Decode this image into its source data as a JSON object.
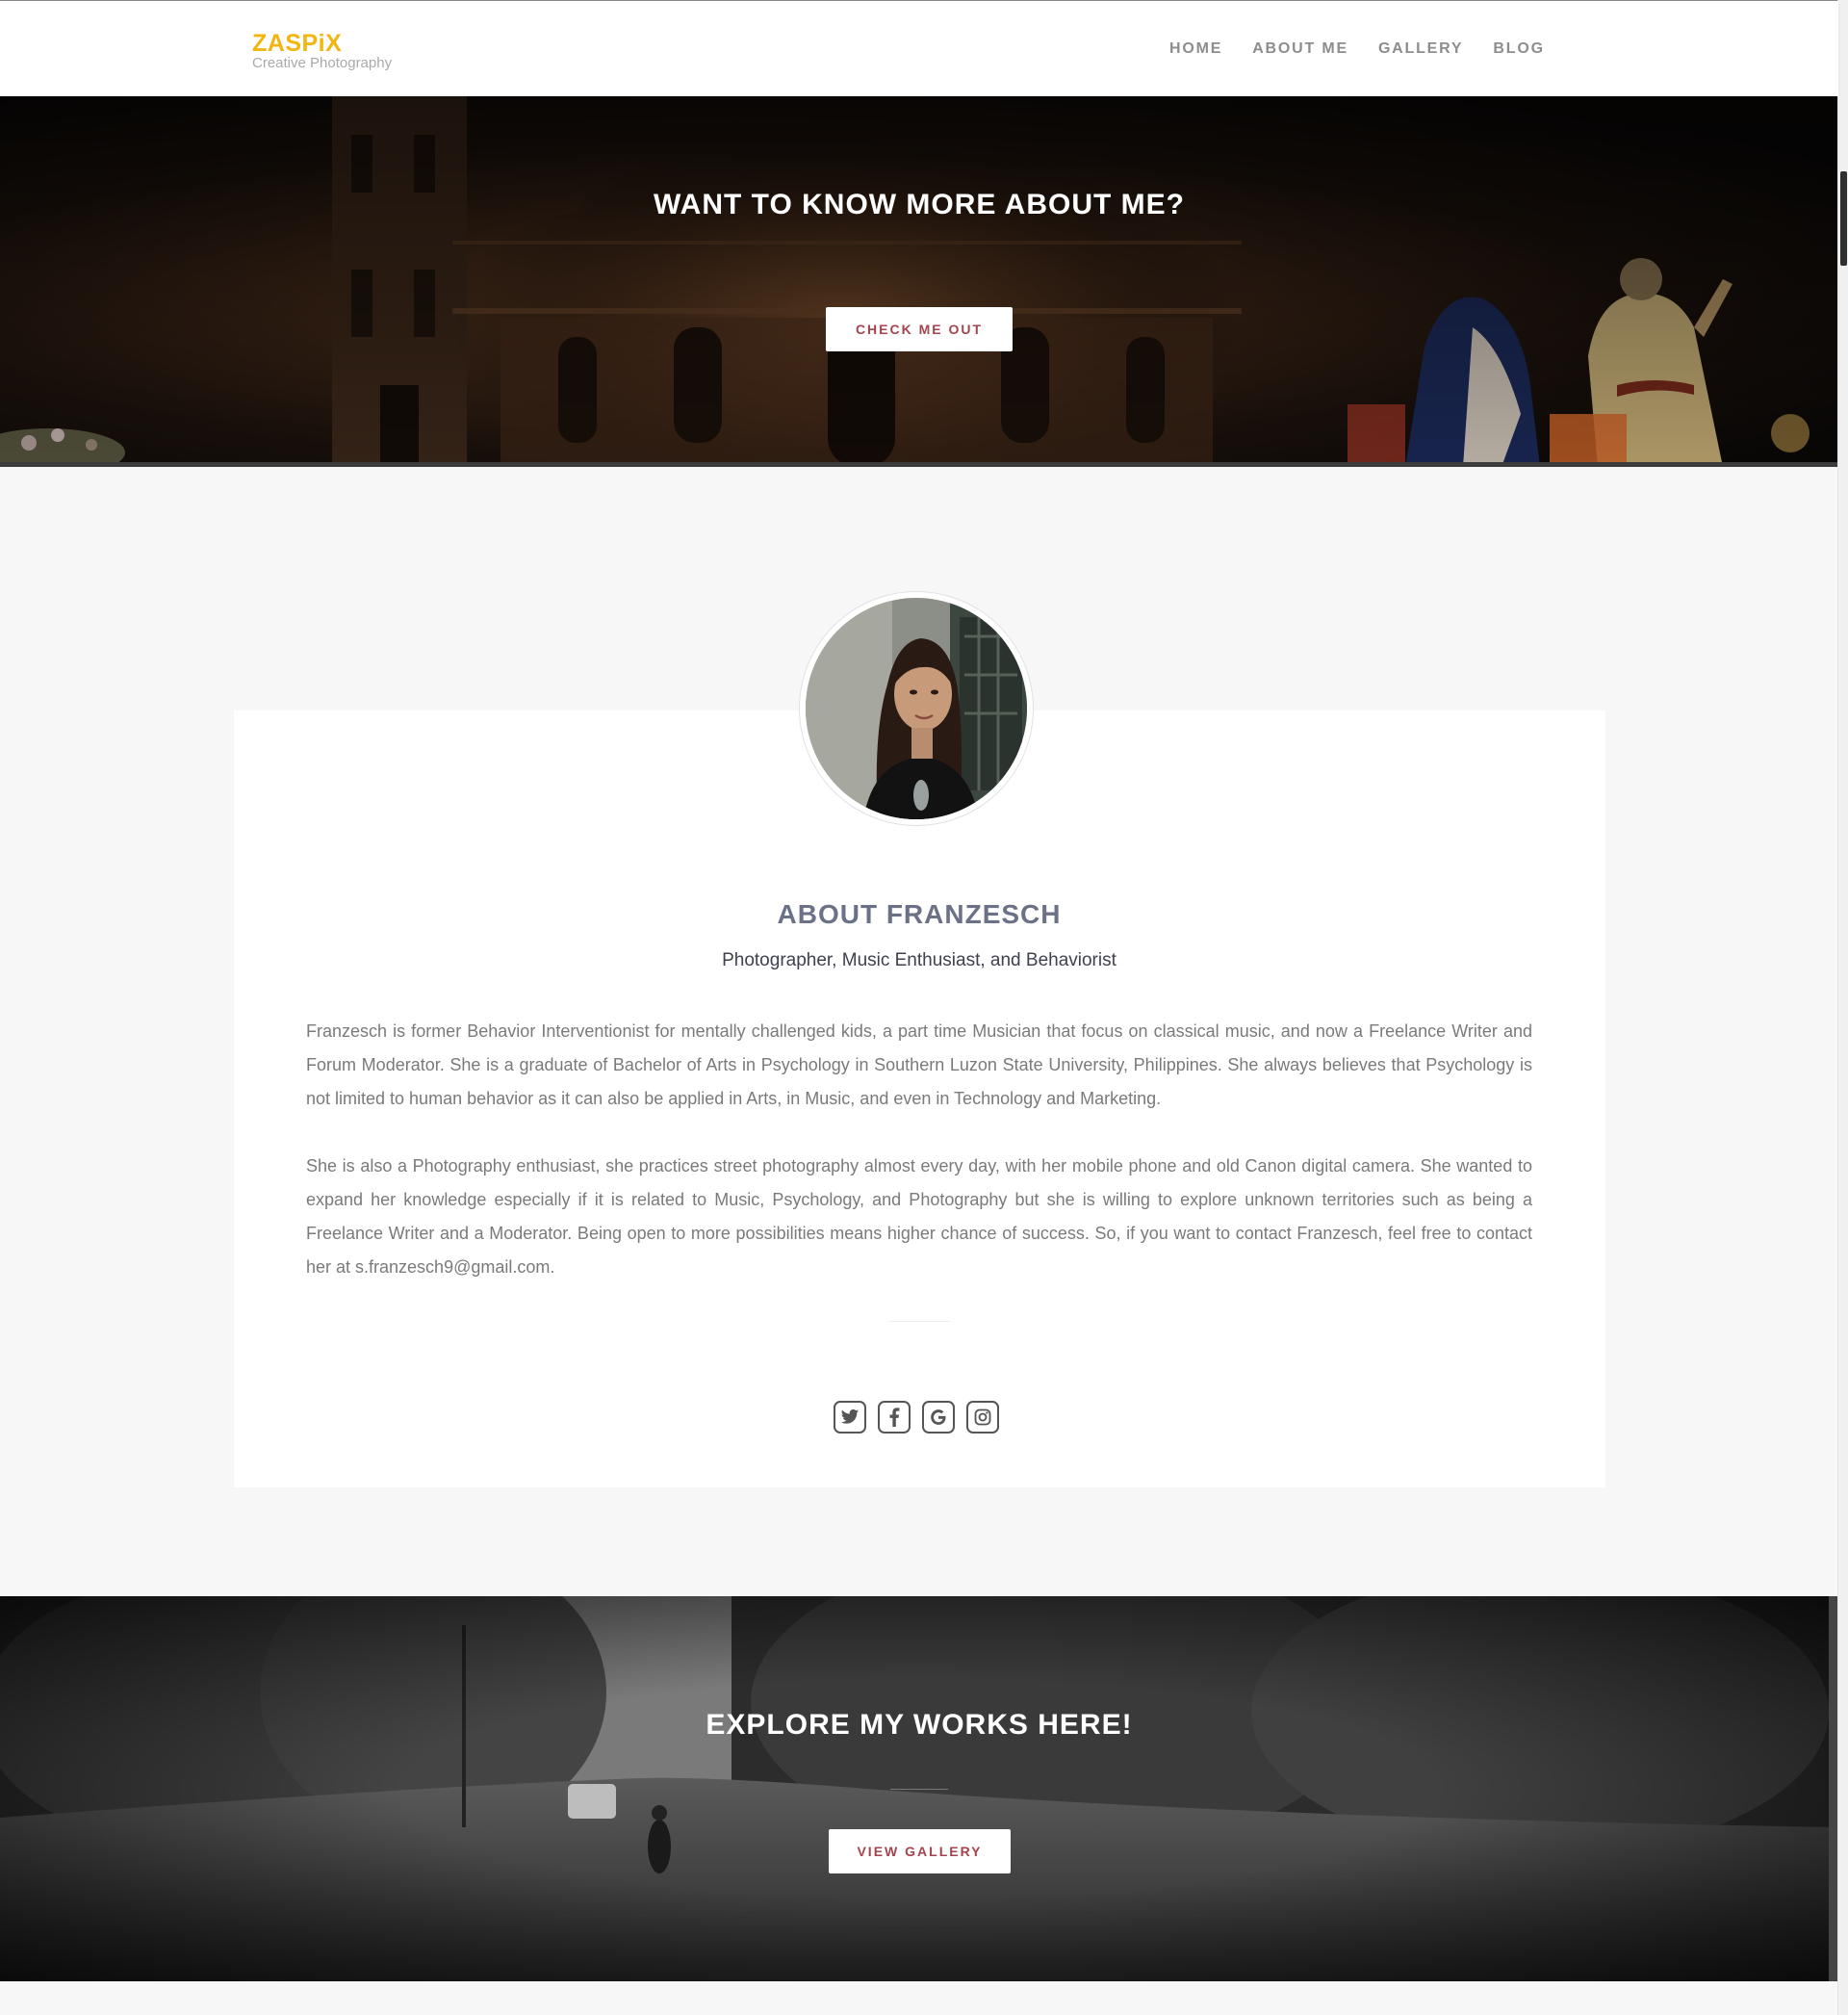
{
  "header": {
    "logo_title": "ZASPiX",
    "logo_subtitle": "Creative Photography",
    "nav": [
      {
        "label": "HOME"
      },
      {
        "label": "ABOUT ME"
      },
      {
        "label": "GALLERY"
      },
      {
        "label": "BLOG"
      }
    ]
  },
  "hero_top": {
    "title": "WANT TO KNOW MORE ABOUT ME?",
    "button_label": "CHECK ME OUT"
  },
  "about": {
    "title": "ABOUT FRANZESCH",
    "subtitle": "Photographer, Music Enthusiast, and Behaviorist",
    "paragraph1": "Franzesch is former Behavior Interventionist for mentally challenged kids, a part time Musician that focus on classical music, and now a Freelance Writer and Forum Moderator. She is a graduate of Bachelor of Arts in Psychology in Southern Luzon State University, Philippines. She always believes that Psychology is not limited to human behavior as it can also be applied in Arts, in Music, and even in Technology and Marketing.",
    "paragraph2": "She is also a Photography enthusiast, she practices street photography almost every day, with her mobile phone and old Canon digital camera. She wanted to expand her knowledge especially if it is related to Music, Psychology, and Photography but she is willing to explore unknown territories such as being a Freelance Writer and a Moderator. Being open to more possibilities means higher chance of success. So, if you want to contact Franzesch, feel free to contact her at s.franzesch9@gmail.com.",
    "social_icons": [
      "twitter-icon",
      "facebook-icon",
      "google-icon",
      "instagram-icon"
    ]
  },
  "hero_bottom": {
    "title": "EXPLORE MY WORKS HERE!",
    "button_label": "VIEW GALLERY"
  },
  "colors": {
    "brand": "#f1b60f",
    "button_text": "#a5434e",
    "about_title": "#6b7187"
  }
}
